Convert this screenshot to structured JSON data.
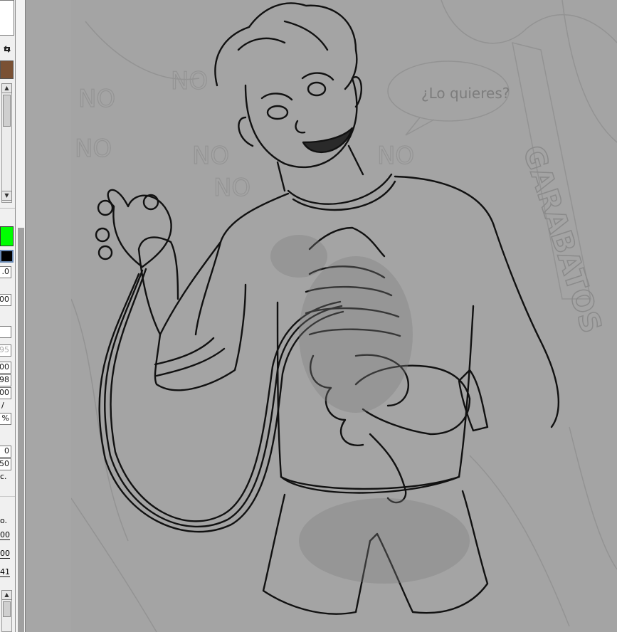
{
  "panel": {
    "colors": {
      "primary": "#7a5134",
      "secondary": "#00ff00",
      "outline": "#000000"
    },
    "fields": [
      {
        "id": "f1",
        "text": ".0"
      },
      {
        "id": "f2",
        "text": "00"
      },
      {
        "id": "f3",
        "text": "95"
      },
      {
        "id": "f4",
        "text": "00"
      },
      {
        "id": "f5",
        "text": "98"
      },
      {
        "id": "f6",
        "text": "00"
      },
      {
        "id": "f7",
        "text": "/"
      },
      {
        "id": "f8",
        "text": "%"
      },
      {
        "id": "f9",
        "text": "0"
      },
      {
        "id": "f10",
        "text": "50"
      },
      {
        "id": "f11",
        "text": "c."
      },
      {
        "id": "f12",
        "text": "o."
      },
      {
        "id": "f13",
        "text": "00"
      },
      {
        "id": "f14",
        "text": "00"
      },
      {
        "id": "f15",
        "text": "41"
      }
    ],
    "swap_icon": "swap-colors-icon",
    "scroll_up_icon": "arrow-up-icon",
    "scroll_down_icon": "arrow-down-icon"
  },
  "canvas": {
    "speech_bubble_text": "¿Lo quieres?",
    "side_text": "GARABATOS",
    "background_words": [
      "NO",
      "NO",
      "NO",
      "NO",
      "NO",
      "NO"
    ]
  }
}
